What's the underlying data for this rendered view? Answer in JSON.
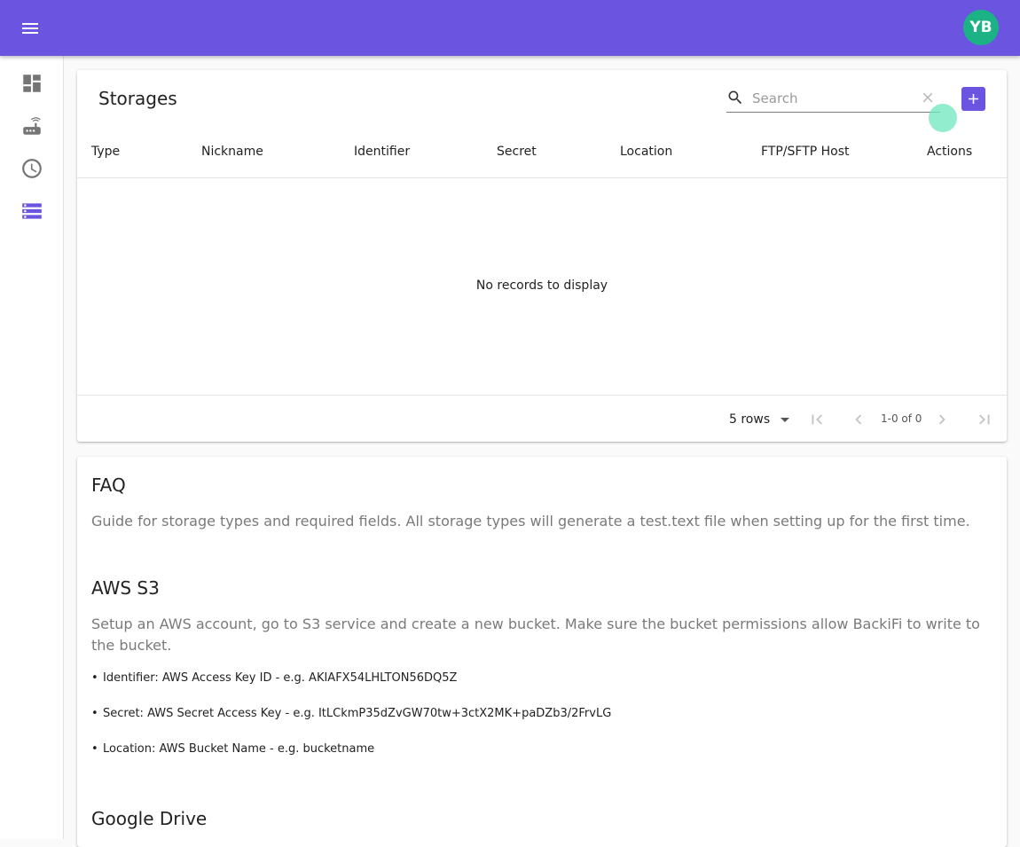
{
  "appbar": {
    "menu_icon": "menu-icon",
    "avatar_initials": "YB",
    "brand_color": "#6a54e0",
    "avatar_color": "#1bb385"
  },
  "sidebar": {
    "items": [
      {
        "icon": "dashboard-icon",
        "active": false
      },
      {
        "icon": "router-icon",
        "active": false
      },
      {
        "icon": "clock-icon",
        "active": false
      },
      {
        "icon": "storage-icon",
        "active": true
      }
    ]
  },
  "storages": {
    "title": "Storages",
    "search_placeholder": "Search",
    "search_value": "",
    "columns": [
      "Type",
      "Nickname",
      "Identifier",
      "Secret",
      "Location",
      "FTP/SFTP Host",
      "Actions"
    ],
    "empty_message": "No records to display",
    "rows_per_page": "5 rows",
    "pagination_text": "1-0 of 0"
  },
  "faq": {
    "title": "FAQ",
    "intro": "Guide for storage types and required fields. All storage types will generate a test.text file when setting up for the first time.",
    "aws": {
      "title": "AWS S3",
      "description": "Setup an AWS account, go to S3 service and create a new bucket. Make sure the bucket permissions allow BackiFi to write to the bucket.",
      "bullets": [
        "Identifier: AWS Access Key ID - e.g. AKIAFX54LHLTON56DQ5Z",
        "Secret: AWS Secret Access Key - e.g. ItLCkmP35dZvGW70tw+3ctX2MK+paDZb3/2FrvLG",
        "Location: AWS Bucket Name - e.g. bucketname"
      ]
    },
    "gdrive": {
      "title": "Google Drive"
    }
  }
}
